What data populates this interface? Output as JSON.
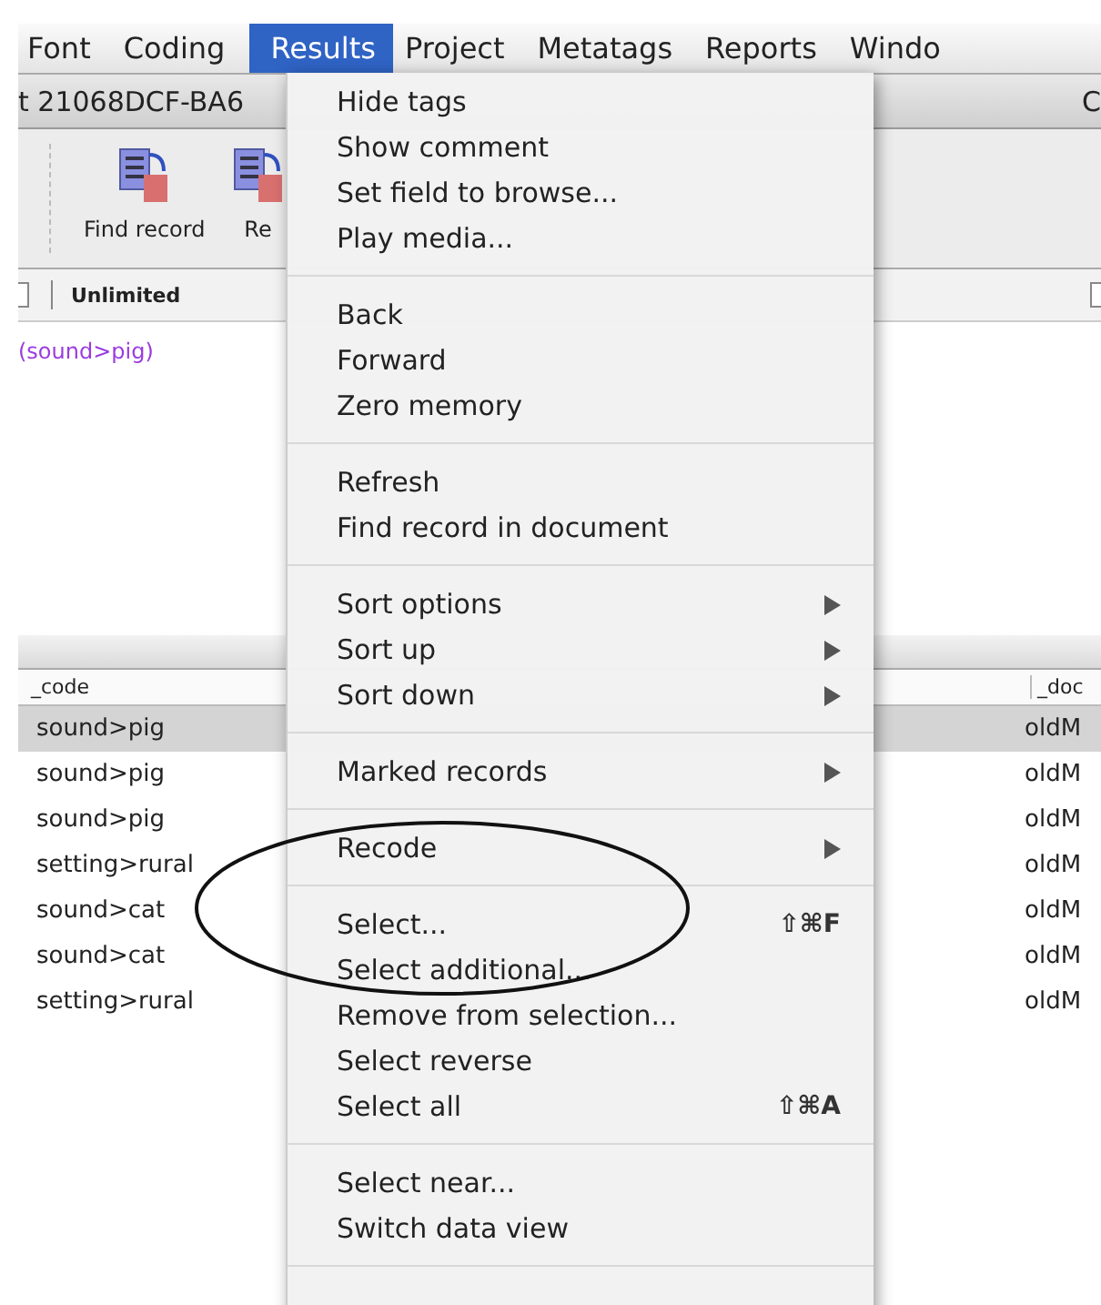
{
  "menubar": [
    {
      "label": "Font",
      "selected": false
    },
    {
      "label": "Coding",
      "selected": false
    },
    {
      "label": "Results",
      "selected": true
    },
    {
      "label": "Project",
      "selected": false
    },
    {
      "label": "Metatags",
      "selected": false
    },
    {
      "label": "Reports",
      "selected": false
    },
    {
      "label": "Windo",
      "selected": false
    }
  ],
  "window": {
    "title": "t 21068DCF-BA6",
    "title_right": "C"
  },
  "toolbar": [
    {
      "label": "Find record"
    },
    {
      "label": "Re"
    }
  ],
  "filter_bar": {
    "limit": "Unlimited",
    "checkboxes": [
      {
        "checked": false
      },
      {
        "checked": false
      }
    ]
  },
  "query": "(sound>pig)",
  "table": {
    "columns": [
      "_code",
      "_doc"
    ],
    "rows": [
      {
        "code": "sound>pig",
        "doc": "oldM",
        "selected": true
      },
      {
        "code": "sound>pig",
        "doc": "oldM",
        "selected": false
      },
      {
        "code": "sound>pig",
        "doc": "oldM",
        "selected": false
      },
      {
        "code": "setting>rural",
        "doc": "oldM",
        "selected": false
      },
      {
        "code": "sound>cat",
        "doc": "oldM",
        "selected": false
      },
      {
        "code": "sound>cat",
        "doc": "oldM",
        "selected": false
      },
      {
        "code": "setting>rural",
        "doc": "oldM",
        "selected": false
      }
    ]
  },
  "menu": [
    {
      "kind": "item",
      "label": "Hide tags"
    },
    {
      "kind": "item",
      "label": "Show comment"
    },
    {
      "kind": "item",
      "label": "Set field to browse..."
    },
    {
      "kind": "item",
      "label": "Play media..."
    },
    {
      "kind": "separator"
    },
    {
      "kind": "item",
      "label": "Back"
    },
    {
      "kind": "item",
      "label": "Forward"
    },
    {
      "kind": "item",
      "label": "Zero memory"
    },
    {
      "kind": "separator"
    },
    {
      "kind": "item",
      "label": "Refresh"
    },
    {
      "kind": "item",
      "label": "Find record in document"
    },
    {
      "kind": "separator"
    },
    {
      "kind": "submenu",
      "label": "Sort options"
    },
    {
      "kind": "submenu",
      "label": "Sort up"
    },
    {
      "kind": "submenu",
      "label": "Sort down"
    },
    {
      "kind": "separator"
    },
    {
      "kind": "submenu",
      "label": "Marked records"
    },
    {
      "kind": "separator"
    },
    {
      "kind": "submenu",
      "label": "Recode"
    },
    {
      "kind": "separator"
    },
    {
      "kind": "item",
      "label": "Select...",
      "shortcut": "⇧⌘F"
    },
    {
      "kind": "item",
      "label": "Select additional..."
    },
    {
      "kind": "item",
      "label": "Remove from selection..."
    },
    {
      "kind": "item",
      "label": "Select reverse"
    },
    {
      "kind": "item",
      "label": "Select all",
      "shortcut": "⇧⌘A"
    },
    {
      "kind": "separator"
    },
    {
      "kind": "item",
      "label": "Select near..."
    },
    {
      "kind": "item",
      "label": "Switch data view"
    },
    {
      "kind": "separator"
    }
  ]
}
